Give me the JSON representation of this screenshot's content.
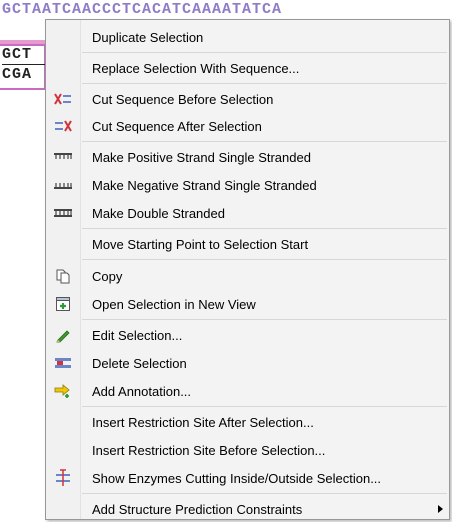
{
  "background": {
    "sequence_top": "GCTAATCAACCCTCACATCAAAATATCA",
    "sequence_line1": "GCT",
    "sequence_line2": "CGA"
  },
  "menu": {
    "items": [
      {
        "label": "Duplicate Selection",
        "icon": "none"
      },
      {
        "label": "Replace Selection With Sequence...",
        "icon": "none"
      },
      {
        "label": "Cut Sequence Before Selection",
        "icon": "cut-before-icon"
      },
      {
        "label": "Cut Sequence After Selection",
        "icon": "cut-after-icon"
      },
      {
        "label": "Make Positive Strand Single Stranded",
        "icon": "positive-strand-icon"
      },
      {
        "label": "Make Negative Strand Single Stranded",
        "icon": "negative-strand-icon"
      },
      {
        "label": "Make Double Stranded",
        "icon": "double-strand-icon"
      },
      {
        "label": "Move Starting Point to Selection Start",
        "icon": "none"
      },
      {
        "label": "Copy",
        "icon": "copy-icon"
      },
      {
        "label": "Open Selection in New View",
        "icon": "new-view-icon"
      },
      {
        "label": "Edit Selection...",
        "icon": "pencil-icon"
      },
      {
        "label": "Delete Selection",
        "icon": "delete-icon"
      },
      {
        "label": "Add Annotation...",
        "icon": "annotation-icon"
      },
      {
        "label": "Insert Restriction Site After Selection...",
        "icon": "none"
      },
      {
        "label": "Insert Restriction Site Before Selection...",
        "icon": "none"
      },
      {
        "label": "Show Enzymes Cutting Inside/Outside Selection...",
        "icon": "enzymes-icon"
      },
      {
        "label": "Add Structure Prediction Constraints",
        "icon": "none"
      }
    ]
  },
  "colors": {
    "menu_bg": "#f3f3f3",
    "separator": "#d7d7d7",
    "sequence_purple": "#8f7cc7",
    "selection_pink": "#c86bc3",
    "cut_red": "#d0343d",
    "pencil_green": "#3a9a2a"
  }
}
